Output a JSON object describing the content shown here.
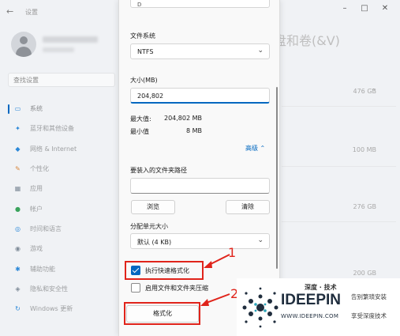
{
  "settings": {
    "app_title": "设置",
    "search_placeholder": "查找设置",
    "nav": [
      {
        "label": "系统",
        "icon": "monitor-icon",
        "color": "#2b88d8"
      },
      {
        "label": "蓝牙和其他设备",
        "icon": "bluetooth-icon",
        "color": "#2b88d8"
      },
      {
        "label": "网络 & Internet",
        "icon": "wifi-icon",
        "color": "#2b88d8"
      },
      {
        "label": "个性化",
        "icon": "brush-icon",
        "color": "#d8863b"
      },
      {
        "label": "应用",
        "icon": "apps-icon",
        "color": "#7f8c99"
      },
      {
        "label": "帐户",
        "icon": "person-icon",
        "color": "#3aa35c"
      },
      {
        "label": "时间和语言",
        "icon": "globe-icon",
        "color": "#2b88d8"
      },
      {
        "label": "游戏",
        "icon": "gamepad-icon",
        "color": "#7f8c99"
      },
      {
        "label": "辅助功能",
        "icon": "accessibility-icon",
        "color": "#2b88d8"
      },
      {
        "label": "隐私和安全性",
        "icon": "shield-icon",
        "color": "#7f8c99"
      },
      {
        "label": "Windows 更新",
        "icon": "update-icon",
        "color": "#2b88d8"
      }
    ],
    "volume_title": "盘和卷(&V)",
    "sizes": [
      "476 GB",
      "100 MB",
      "276 GB",
      "200 GB"
    ]
  },
  "dialog": {
    "partial_value": "D",
    "filesystem_label": "文件系统",
    "filesystem_value": "NTFS",
    "size_label": "大小(MB)",
    "size_value": "204,802",
    "max_label": "最大值:",
    "max_value": "204,802 MB",
    "min_label": "最小值",
    "min_value": "8 MB",
    "advanced_label": "高级",
    "mount_path_label": "要装入的文件夹路径",
    "browse_label": "浏览",
    "clear_label": "清除",
    "cluster_label": "分配单元大小",
    "cluster_value": "默认 (4 KB)",
    "quick_format_label": "执行快速格式化",
    "quick_format_checked": true,
    "compression_label": "启用文件和文件夹压缩",
    "compression_checked": false,
    "format_button_label": "格式化"
  },
  "annotations": {
    "step1": "1",
    "step2": "2",
    "color": "#e0241b"
  },
  "watermark": {
    "title": "深度 · 技术",
    "brand": "IDEEPIN",
    "url": "WWW.IDEEPIN.COM",
    "tag1": "告别繁琐安装",
    "tag2": "享受深度技术"
  }
}
